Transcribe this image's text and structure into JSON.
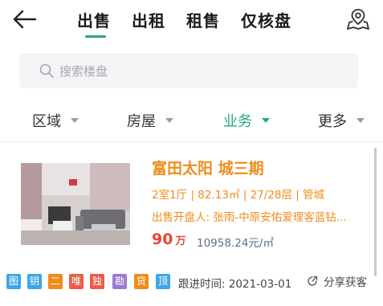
{
  "nav": {
    "tabs": [
      {
        "label": "出售"
      },
      {
        "label": "出租"
      },
      {
        "label": "租售"
      },
      {
        "label": "仅核盘"
      }
    ],
    "active_tab": 0,
    "back_icon": "arrow-left-icon",
    "map_icon": "map-location-icon"
  },
  "search": {
    "placeholder": "搜索楼盘",
    "icon": "search-icon"
  },
  "filters": [
    {
      "label": "区域",
      "active": false
    },
    {
      "label": "房屋",
      "active": false
    },
    {
      "label": "业务",
      "active": true
    },
    {
      "label": "更多",
      "active": false
    }
  ],
  "listing": {
    "title": "富田太阳 城三期",
    "specs": "2室1厅 | 82.13㎡ | 27/28层 | 管城",
    "agent": "出售开盘人: 张雨-中原安佑爱理客蓝钻...",
    "price": "90",
    "price_unit": "万",
    "unit_price": "10958.24元/㎡",
    "tags": [
      {
        "label": "图",
        "color": "#3ea7e6"
      },
      {
        "label": "钥",
        "color": "#3ea7e6"
      },
      {
        "label": "二",
        "color": "#f08c1a"
      },
      {
        "label": "唯",
        "color": "#f05a4a"
      },
      {
        "label": "独",
        "color": "#f05a4a"
      },
      {
        "label": "勘",
        "color": "#9b7ad6"
      },
      {
        "label": "贷",
        "color": "#f08c1a"
      },
      {
        "label": "顶",
        "color": "#3ea7e6"
      }
    ],
    "follow_up": "跟进时间: 2021-03-01",
    "share_label": "分享获客"
  },
  "colors": {
    "accent": "#27a97a",
    "highlight": "#f08c1a",
    "price": "#e8473a"
  }
}
